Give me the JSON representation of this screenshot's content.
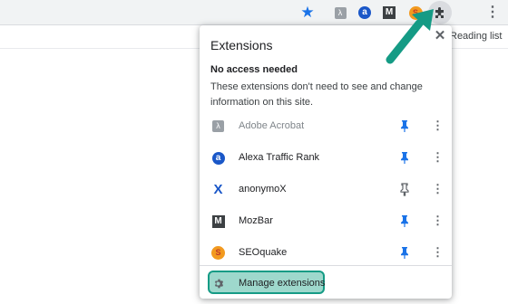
{
  "toolbar": {
    "icons": [
      "star-icon",
      "adobe-acrobat-icon",
      "alexa-icon",
      "mozbar-icon",
      "seoquake-icon",
      "puzzle-icon",
      "kebab-menu-icon"
    ],
    "accent": "#1a73e8"
  },
  "bookmarks": {
    "reading_list": "Reading list"
  },
  "popup": {
    "title": "Extensions",
    "close_icon": "close-icon",
    "section_title": "No access needed",
    "section_desc": "These extensions don't need to see and change information on this site.",
    "extensions": [
      {
        "name": "Adobe Acrobat",
        "icon": "adobe-acrobat-icon",
        "pinned": true,
        "dimmed": true
      },
      {
        "name": "Alexa Traffic Rank",
        "icon": "alexa-icon",
        "pinned": true,
        "dimmed": false
      },
      {
        "name": "anonymoX",
        "icon": "anonymox-icon",
        "pinned": false,
        "dimmed": false
      },
      {
        "name": "MozBar",
        "icon": "mozbar-icon",
        "pinned": true,
        "dimmed": false
      },
      {
        "name": "SEOquake",
        "icon": "seoquake-icon",
        "pinned": true,
        "dimmed": false
      }
    ],
    "manage_label": "Manage extensions",
    "highlight_color": "#159b85",
    "highlight_fill": "#9ed8cc",
    "arrow_color": "#159b85"
  }
}
